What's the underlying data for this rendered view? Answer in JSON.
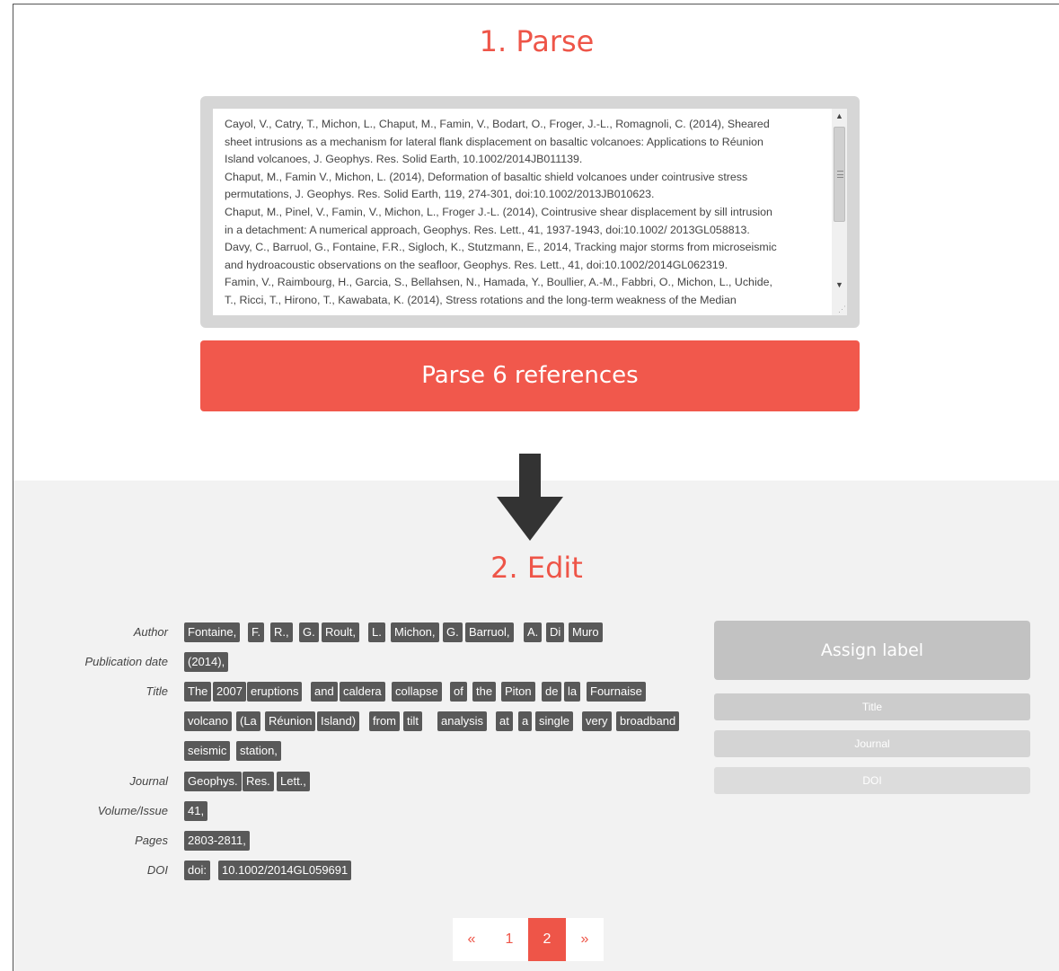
{
  "parse": {
    "title": "1. Parse",
    "references_lines": [
      "Cayol, V., Catry, T., Michon, L., Chaput, M., Famin, V., Bodart, O., Froger, J.-L., Romagnoli, C. (2014), Sheared",
      "sheet intrusions as a mechanism for lateral flank displacement on basaltic volcanoes: Applications to Réunion",
      "Island volcanoes, J. Geophys. Res. Solid Earth, 10.1002/2014JB011139.",
      "Chaput, M., Famin V., Michon, L. (2014), Deformation of basaltic shield volcanoes under cointrusive stress",
      "permutations, J. Geophys. Res. Solid Earth, 119, 274-301, doi:10.1002/2013JB010623.",
      "Chaput, M., Pinel, V., Famin, V., Michon, L., Froger J.-L. (2014), Cointrusive shear displacement by sill intrusion",
      "in a detachment: A numerical approach, Geophys. Res. Lett., 41, 1937-1943, doi:10.1002/ 2013GL058813.",
      "Davy, C., Barruol, G., Fontaine, F.R., Sigloch, K., Stutzmann, E., 2014, Tracking major storms from microseismic",
      "and hydroacoustic observations on the seafloor, Geophys. Res. Lett., 41, doi:10.1002/2014GL062319.",
      "Famin, V., Raimbourg, H., Garcia, S., Bellahsen, N., Hamada, Y.,  Boullier, A.-M., Fabbri, O., Michon, L., Uchide,",
      "T., Ricci, T., Hirono, T.,  Kawabata, K. (2014), Stress rotations and the long-term weakness of the Median"
    ],
    "parse_button": "Parse 6 references"
  },
  "edit": {
    "title": "2. Edit",
    "fields": {
      "author": {
        "label": "Author",
        "tokens": [
          "Fontaine,",
          "F.",
          "R.,",
          "G.",
          "Roult,",
          "L.",
          "Michon,",
          "G.",
          "Barruol,",
          "A.",
          "Di",
          "Muro"
        ]
      },
      "publication_date": {
        "label": "Publication date",
        "tokens": [
          "(2014),"
        ]
      },
      "title": {
        "label": "Title",
        "tokens": [
          "The",
          "2007",
          "eruptions",
          "and",
          "caldera",
          "collapse",
          "of",
          "the",
          "Piton",
          "de",
          "la",
          "Fournaise",
          "volcano",
          "(La",
          "Réunion",
          "Island)",
          "from",
          "tilt",
          "analysis",
          "at",
          "a",
          "single",
          "very",
          "broadband",
          "seismic",
          "station,"
        ]
      },
      "journal": {
        "label": "Journal",
        "tokens": [
          "Geophys.",
          "Res.",
          "Lett.,"
        ]
      },
      "volume_issue": {
        "label": "Volume/Issue",
        "tokens": [
          "41,"
        ]
      },
      "pages": {
        "label": "Pages",
        "tokens": [
          "2803-2811,"
        ]
      },
      "doi": {
        "label": "DOI",
        "tokens": [
          "doi:",
          "10.1002/2014GL059691"
        ]
      }
    },
    "assign": {
      "button": "Assign label",
      "options": [
        {
          "label": "Title",
          "color": "#cccccc"
        },
        {
          "label": "Journal",
          "color": "#d4d4d4"
        },
        {
          "label": "DOI",
          "color": "#dcdcdc"
        }
      ]
    },
    "pagination": {
      "prev": "«",
      "pages": [
        "1",
        "2"
      ],
      "active": "2",
      "next": "»"
    }
  },
  "colors": {
    "accent": "#ee5548",
    "token_bg": "#595959",
    "assign_bg": "#c2c2c2"
  }
}
